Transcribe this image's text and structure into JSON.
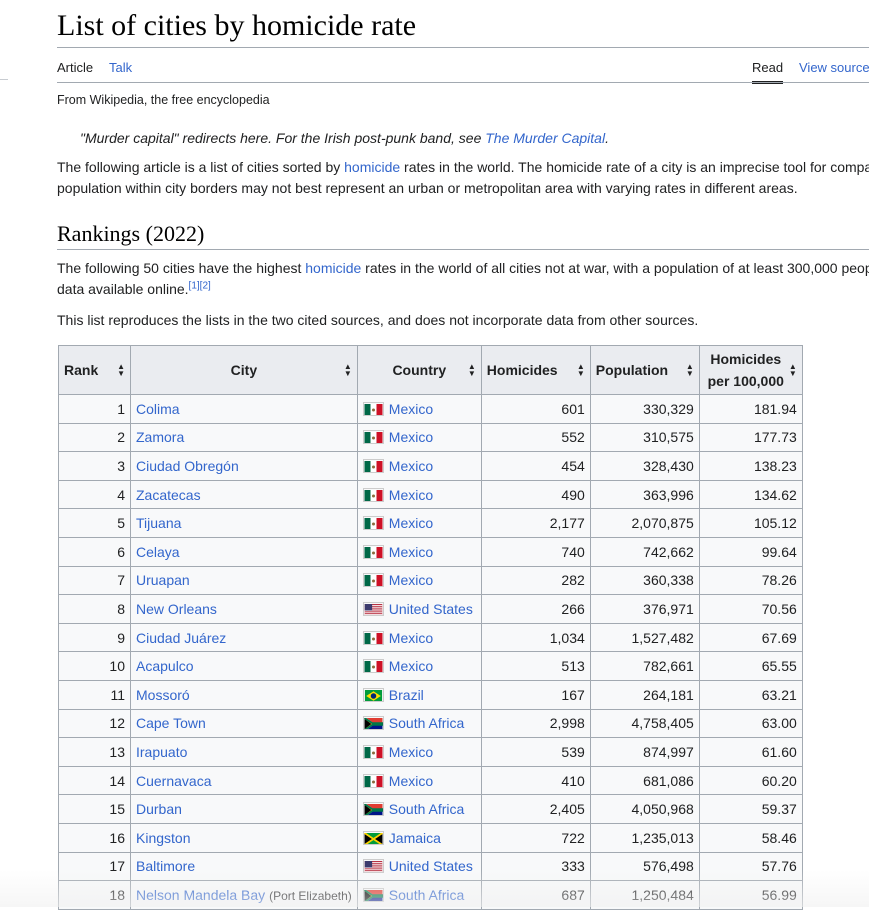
{
  "page": {
    "title": "List of cities by homicide rate",
    "tabs": {
      "article": "Article",
      "talk": "Talk",
      "read": "Read",
      "view_source": "View source"
    },
    "tagline": "From Wikipedia, the free encyclopedia",
    "hatnote": {
      "text": "\"Murder capital\" redirects here. For the Irish post-punk band, see ",
      "link": "The Murder Capital",
      "end": "."
    },
    "intro": {
      "line1_pre": "The following article is a list of cities sorted by ",
      "line1_link": "homicide",
      "line1_post": " rates in the world. The homicide rate of a city is an imprecise tool for compa",
      "line2": "population within city borders may not best represent an urban or metropolitan area with varying rates in different areas."
    },
    "section_heading": "Rankings (2022)",
    "rankings_para": {
      "line1_pre": "The following 50 cities have the highest ",
      "line1_link": "homicide",
      "line1_post": " rates in the world of all cities not at war, with a population of at least 300,000 peop",
      "line2": "data available online.",
      "refs": "[1][2]"
    },
    "list_note": "This list reproduces the lists in the two cited sources, and does not incorporate data from other sources."
  },
  "table": {
    "headers": {
      "rank": "Rank",
      "city": "City",
      "country": "Country",
      "homicides": "Homicides",
      "population": "Population",
      "rate_line1": "Homicides",
      "rate_line2": "per 100,000"
    },
    "sort_icon": "sort-arrows-icon",
    "rows": [
      {
        "rank": "1",
        "city": "Colima",
        "note": "",
        "country": "Mexico",
        "flag": "mexico",
        "homicides": "601",
        "population": "330,329",
        "rate": "181.94"
      },
      {
        "rank": "2",
        "city": "Zamora",
        "note": "",
        "country": "Mexico",
        "flag": "mexico",
        "homicides": "552",
        "population": "310,575",
        "rate": "177.73"
      },
      {
        "rank": "3",
        "city": "Ciudad Obregón",
        "note": "",
        "country": "Mexico",
        "flag": "mexico",
        "homicides": "454",
        "population": "328,430",
        "rate": "138.23"
      },
      {
        "rank": "4",
        "city": "Zacatecas",
        "note": "",
        "country": "Mexico",
        "flag": "mexico",
        "homicides": "490",
        "population": "363,996",
        "rate": "134.62"
      },
      {
        "rank": "5",
        "city": "Tijuana",
        "note": "",
        "country": "Mexico",
        "flag": "mexico",
        "homicides": "2,177",
        "population": "2,070,875",
        "rate": "105.12"
      },
      {
        "rank": "6",
        "city": "Celaya",
        "note": "",
        "country": "Mexico",
        "flag": "mexico",
        "homicides": "740",
        "population": "742,662",
        "rate": "99.64"
      },
      {
        "rank": "7",
        "city": "Uruapan",
        "note": "",
        "country": "Mexico",
        "flag": "mexico",
        "homicides": "282",
        "population": "360,338",
        "rate": "78.26"
      },
      {
        "rank": "8",
        "city": "New Orleans",
        "note": "",
        "country": "United States",
        "flag": "usa",
        "homicides": "266",
        "population": "376,971",
        "rate": "70.56"
      },
      {
        "rank": "9",
        "city": "Ciudad Juárez",
        "note": "",
        "country": "Mexico",
        "flag": "mexico",
        "homicides": "1,034",
        "population": "1,527,482",
        "rate": "67.69"
      },
      {
        "rank": "10",
        "city": "Acapulco",
        "note": "",
        "country": "Mexico",
        "flag": "mexico",
        "homicides": "513",
        "population": "782,661",
        "rate": "65.55"
      },
      {
        "rank": "11",
        "city": "Mossoró",
        "note": "",
        "country": "Brazil",
        "flag": "brazil",
        "homicides": "167",
        "population": "264,181",
        "rate": "63.21"
      },
      {
        "rank": "12",
        "city": "Cape Town",
        "note": "",
        "country": "South Africa",
        "flag": "southafrica",
        "homicides": "2,998",
        "population": "4,758,405",
        "rate": "63.00"
      },
      {
        "rank": "13",
        "city": "Irapuato",
        "note": "",
        "country": "Mexico",
        "flag": "mexico",
        "homicides": "539",
        "population": "874,997",
        "rate": "61.60"
      },
      {
        "rank": "14",
        "city": "Cuernavaca",
        "note": "",
        "country": "Mexico",
        "flag": "mexico",
        "homicides": "410",
        "population": "681,086",
        "rate": "60.20"
      },
      {
        "rank": "15",
        "city": "Durban",
        "note": "",
        "country": "South Africa",
        "flag": "southafrica",
        "homicides": "2,405",
        "population": "4,050,968",
        "rate": "59.37"
      },
      {
        "rank": "16",
        "city": "Kingston",
        "note": "",
        "country": "Jamaica",
        "flag": "jamaica",
        "homicides": "722",
        "population": "1,235,013",
        "rate": "58.46"
      },
      {
        "rank": "17",
        "city": "Baltimore",
        "note": "",
        "country": "United States",
        "flag": "usa",
        "homicides": "333",
        "population": "576,498",
        "rate": "57.76"
      },
      {
        "rank": "18",
        "city": "Nelson Mandela Bay",
        "note": "(Port Elizabeth)",
        "country": "South Africa",
        "flag": "southafrica",
        "homicides": "687",
        "population": "1,250,484",
        "rate": "56.99"
      }
    ]
  },
  "colors": {
    "link": "#3366cc",
    "header_bg": "#eaecf0",
    "border": "#a2a9b1",
    "cell_bg": "#f8f9fa"
  }
}
